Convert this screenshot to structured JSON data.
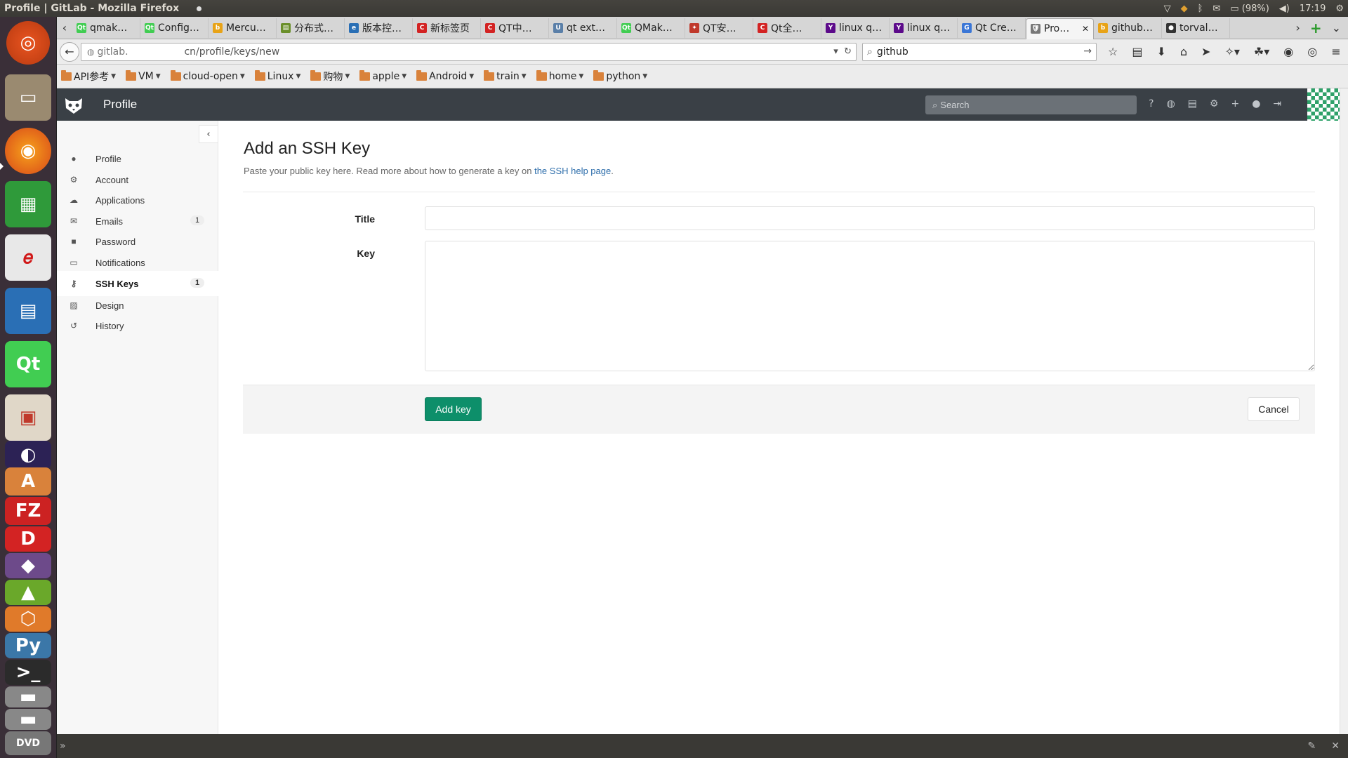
{
  "window": {
    "title": "Profile | GitLab - Mozilla Firefox"
  },
  "system": {
    "battery": "(98%)",
    "clock": "17:19"
  },
  "tabs": [
    {
      "label": "qmak…",
      "fav": "Qt",
      "color": "#41cd52"
    },
    {
      "label": "Config…",
      "fav": "Qt",
      "color": "#41cd52"
    },
    {
      "label": "Mercu…",
      "fav": "b",
      "color": "#e8a317"
    },
    {
      "label": "分布式…",
      "fav": "▤",
      "color": "#6a8f2a"
    },
    {
      "label": "版本控…",
      "fav": "e",
      "color": "#2a6fb5"
    },
    {
      "label": "新标签页",
      "fav": "C",
      "color": "#d32323"
    },
    {
      "label": "QT中…",
      "fav": "C",
      "color": "#d32323"
    },
    {
      "label": "qt ext…",
      "fav": "U",
      "color": "#5a7fa8"
    },
    {
      "label": "QMak…",
      "fav": "Qt",
      "color": "#41cd52"
    },
    {
      "label": "QT安…",
      "fav": "✦",
      "color": "#c0392b"
    },
    {
      "label": "Qt全…",
      "fav": "C",
      "color": "#d32323"
    },
    {
      "label": "linux q…",
      "fav": "Y",
      "color": "#5c0a8a"
    },
    {
      "label": "linux q…",
      "fav": "Y",
      "color": "#5c0a8a"
    },
    {
      "label": "Qt Cre…",
      "fav": "G",
      "color": "#3a76d6"
    },
    {
      "label": "Pro…",
      "fav": "🛡",
      "color": "#777777",
      "active": true
    },
    {
      "label": "github…",
      "fav": "b",
      "color": "#e8a317"
    },
    {
      "label": "torval…",
      "fav": "●",
      "color": "#333333"
    }
  ],
  "urlbar": {
    "host": "gitlab.",
    "path": "cn/profile/keys/new"
  },
  "searchbar": {
    "value": "github"
  },
  "bookmarks": [
    {
      "label": "API参考"
    },
    {
      "label": "VM"
    },
    {
      "label": "cloud-open"
    },
    {
      "label": "Linux"
    },
    {
      "label": "购物"
    },
    {
      "label": "apple"
    },
    {
      "label": "Android"
    },
    {
      "label": "train"
    },
    {
      "label": "home"
    },
    {
      "label": "python"
    }
  ],
  "gitlab": {
    "header_title": "Profile",
    "search_placeholder": "Search",
    "sidebar": [
      {
        "label": "Profile",
        "icon": "user-icon",
        "glyph": "●"
      },
      {
        "label": "Account",
        "icon": "gear-icon",
        "glyph": "⚙"
      },
      {
        "label": "Applications",
        "icon": "cloud-icon",
        "glyph": "☁"
      },
      {
        "label": "Emails",
        "icon": "envelope-icon",
        "glyph": "✉",
        "badge": "1"
      },
      {
        "label": "Password",
        "icon": "lock-icon",
        "glyph": "■"
      },
      {
        "label": "Notifications",
        "icon": "inbox-icon",
        "glyph": "▭"
      },
      {
        "label": "SSH Keys",
        "icon": "key-icon",
        "glyph": "⚷",
        "badge": "1",
        "active": true
      },
      {
        "label": "Design",
        "icon": "image-icon",
        "glyph": "▨"
      },
      {
        "label": "History",
        "icon": "history-icon",
        "glyph": "↺"
      }
    ],
    "page_title": "Add an SSH Key",
    "subtitle_text": "Paste your public key here. Read more about how to generate a key on ",
    "subtitle_link": "the SSH help page",
    "subtitle_end": ".",
    "title_label": "Title",
    "key_label": "Key",
    "title_value": "",
    "key_value": "",
    "add_button": "Add key",
    "cancel_button": "Cancel",
    "accent": "#0d8f6a"
  }
}
